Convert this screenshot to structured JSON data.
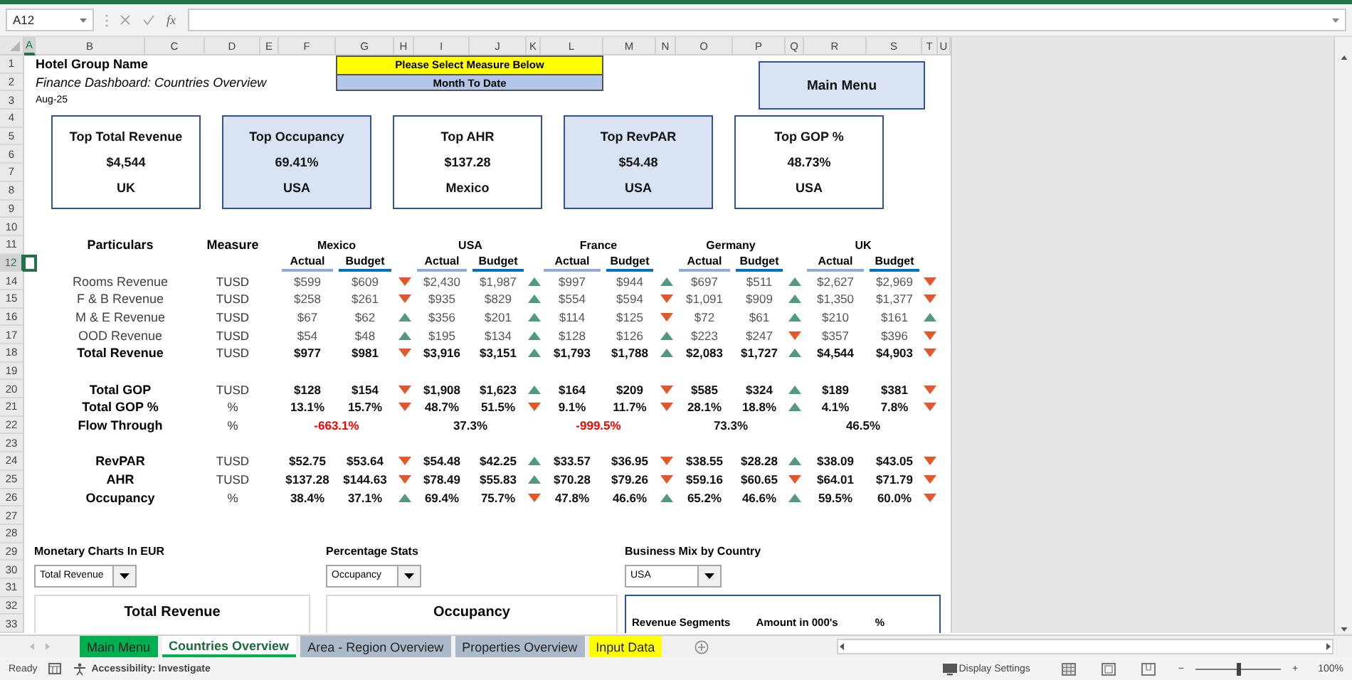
{
  "formula_bar": {
    "name_box": "A12",
    "function_label": "fx"
  },
  "columns": [
    {
      "label": "A",
      "selected": true
    },
    {
      "label": "B",
      "selected": false
    },
    {
      "label": "C",
      "selected": false
    },
    {
      "label": "D",
      "selected": false
    },
    {
      "label": "E",
      "selected": false
    },
    {
      "label": "F",
      "selected": false
    },
    {
      "label": "G",
      "selected": false
    },
    {
      "label": "H",
      "selected": false
    },
    {
      "label": "I",
      "selected": false
    },
    {
      "label": "J",
      "selected": false
    },
    {
      "label": "K",
      "selected": false
    },
    {
      "label": "L",
      "selected": false
    },
    {
      "label": "M",
      "selected": false
    },
    {
      "label": "N",
      "selected": false
    },
    {
      "label": "O",
      "selected": false
    },
    {
      "label": "P",
      "selected": false
    },
    {
      "label": "Q",
      "selected": false
    },
    {
      "label": "R",
      "selected": false
    },
    {
      "label": "S",
      "selected": false
    },
    {
      "label": "T",
      "selected": false
    },
    {
      "label": "U",
      "selected": false
    }
  ],
  "rows": [
    {
      "label": "1",
      "selected": false
    },
    {
      "label": "2",
      "selected": false
    },
    {
      "label": "3",
      "selected": false
    },
    {
      "label": "4",
      "selected": false
    },
    {
      "label": "5",
      "selected": false
    },
    {
      "label": "6",
      "selected": false
    },
    {
      "label": "7",
      "selected": false
    },
    {
      "label": "8",
      "selected": false
    },
    {
      "label": "9",
      "selected": false
    },
    {
      "label": "10",
      "selected": false
    },
    {
      "label": "11",
      "selected": false
    },
    {
      "label": "12",
      "selected": true
    },
    {
      "label": "14",
      "selected": false
    },
    {
      "label": "15",
      "selected": false
    },
    {
      "label": "16",
      "selected": false
    },
    {
      "label": "17",
      "selected": false
    },
    {
      "label": "18",
      "selected": false
    },
    {
      "label": "19",
      "selected": false
    },
    {
      "label": "20",
      "selected": false
    },
    {
      "label": "21",
      "selected": false
    },
    {
      "label": "22",
      "selected": false
    },
    {
      "label": "23",
      "selected": false
    },
    {
      "label": "24",
      "selected": false
    },
    {
      "label": "25",
      "selected": false
    },
    {
      "label": "26",
      "selected": false
    },
    {
      "label": "27",
      "selected": false
    },
    {
      "label": "28",
      "selected": false
    },
    {
      "label": "29",
      "selected": false
    },
    {
      "label": "30",
      "selected": false
    },
    {
      "label": "31",
      "selected": false
    },
    {
      "label": "32",
      "selected": false
    },
    {
      "label": "33",
      "selected": false
    }
  ],
  "header": {
    "title": "Hotel Group Name",
    "subtitle": "Finance Dashboard: Countries Overview",
    "period": "Aug-25"
  },
  "measure_selector": {
    "prompt": "Please Select Measure Below",
    "value": "Month To Date"
  },
  "main_menu_button": "Main Menu",
  "kpi_cards": [
    {
      "title": "Top Total Revenue",
      "value": "$4,544",
      "country": "UK",
      "shaded": false
    },
    {
      "title": "Top Occupancy",
      "value": "69.41%",
      "country": "USA",
      "shaded": true
    },
    {
      "title": "Top AHR",
      "value": "$137.28",
      "country": "Mexico",
      "shaded": false
    },
    {
      "title": "Top RevPAR",
      "value": "$54.48",
      "country": "USA",
      "shaded": true
    },
    {
      "title": "Top GOP %",
      "value": "48.73%",
      "country": "USA",
      "shaded": false
    }
  ],
  "table": {
    "particulars_heading": "Particulars",
    "measure_heading": "Measure",
    "countries": [
      {
        "name": "Mexico",
        "actual_heading": "Actual",
        "budget_heading": "Budget"
      },
      {
        "name": "USA",
        "actual_heading": "Actual",
        "budget_heading": "Budget"
      },
      {
        "name": "France",
        "actual_heading": "Actual",
        "budget_heading": "Budget"
      },
      {
        "name": "Germany",
        "actual_heading": "Actual",
        "budget_heading": "Budget"
      },
      {
        "name": "UK",
        "actual_heading": "Actual",
        "budget_heading": "Budget"
      }
    ],
    "sections": [
      {
        "rows": [
          {
            "kind": "pair",
            "label": "Rooms Revenue",
            "bold": false,
            "measure": "TUSD",
            "cells": [
              {
                "actual": "$599",
                "budget": "$609",
                "above_budget": false
              },
              {
                "actual": "$2,430",
                "budget": "$1,987",
                "above_budget": true
              },
              {
                "actual": "$997",
                "budget": "$944",
                "above_budget": true
              },
              {
                "actual": "$697",
                "budget": "$511",
                "above_budget": true
              },
              {
                "actual": "$2,627",
                "budget": "$2,969",
                "above_budget": false
              }
            ]
          },
          {
            "kind": "pair",
            "label": "F & B Revenue",
            "bold": false,
            "measure": "TUSD",
            "cells": [
              {
                "actual": "$258",
                "budget": "$261",
                "above_budget": false
              },
              {
                "actual": "$935",
                "budget": "$829",
                "above_budget": true
              },
              {
                "actual": "$554",
                "budget": "$594",
                "above_budget": false
              },
              {
                "actual": "$1,091",
                "budget": "$909",
                "above_budget": true
              },
              {
                "actual": "$1,350",
                "budget": "$1,377",
                "above_budget": false
              }
            ]
          },
          {
            "kind": "pair",
            "label": "M & E Revenue",
            "bold": false,
            "measure": "TUSD",
            "cells": [
              {
                "actual": "$67",
                "budget": "$62",
                "above_budget": true
              },
              {
                "actual": "$356",
                "budget": "$201",
                "above_budget": true
              },
              {
                "actual": "$114",
                "budget": "$125",
                "above_budget": false
              },
              {
                "actual": "$72",
                "budget": "$61",
                "above_budget": true
              },
              {
                "actual": "$210",
                "budget": "$161",
                "above_budget": true
              }
            ]
          },
          {
            "kind": "pair",
            "label": "OOD Revenue",
            "bold": false,
            "measure": "TUSD",
            "cells": [
              {
                "actual": "$54",
                "budget": "$48",
                "above_budget": true
              },
              {
                "actual": "$195",
                "budget": "$134",
                "above_budget": true
              },
              {
                "actual": "$128",
                "budget": "$126",
                "above_budget": true
              },
              {
                "actual": "$223",
                "budget": "$247",
                "above_budget": false
              },
              {
                "actual": "$357",
                "budget": "$396",
                "above_budget": false
              }
            ]
          },
          {
            "kind": "pair",
            "label": "Total Revenue",
            "bold": true,
            "measure": "TUSD",
            "cells": [
              {
                "actual": "$977",
                "budget": "$981",
                "above_budget": false
              },
              {
                "actual": "$3,916",
                "budget": "$3,151",
                "above_budget": true
              },
              {
                "actual": "$1,793",
                "budget": "$1,788",
                "above_budget": true
              },
              {
                "actual": "$2,083",
                "budget": "$1,727",
                "above_budget": true
              },
              {
                "actual": "$4,544",
                "budget": "$4,903",
                "above_budget": false
              }
            ]
          }
        ]
      },
      {
        "rows": [
          {
            "kind": "pair",
            "label": "Total GOP",
            "bold": true,
            "measure": "TUSD",
            "cells": [
              {
                "actual": "$128",
                "budget": "$154",
                "above_budget": false
              },
              {
                "actual": "$1,908",
                "budget": "$1,623",
                "above_budget": true
              },
              {
                "actual": "$164",
                "budget": "$209",
                "above_budget": false
              },
              {
                "actual": "$585",
                "budget": "$324",
                "above_budget": true
              },
              {
                "actual": "$189",
                "budget": "$381",
                "above_budget": false
              }
            ]
          },
          {
            "kind": "pair",
            "label": "Total GOP %",
            "bold": true,
            "measure": "%",
            "cells": [
              {
                "actual": "13.1%",
                "budget": "15.7%",
                "above_budget": false
              },
              {
                "actual": "48.7%",
                "budget": "51.5%",
                "above_budget": false
              },
              {
                "actual": "9.1%",
                "budget": "11.7%",
                "above_budget": false
              },
              {
                "actual": "28.1%",
                "budget": "18.8%",
                "above_budget": true
              },
              {
                "actual": "4.1%",
                "budget": "7.8%",
                "above_budget": false
              }
            ]
          },
          {
            "kind": "merged",
            "label": "Flow Through",
            "bold": true,
            "measure": "%",
            "cells": [
              {
                "value": "-663.1%",
                "negative": true
              },
              {
                "value": "37.3%",
                "negative": false
              },
              {
                "value": "-999.5%",
                "negative": true
              },
              {
                "value": "73.3%",
                "negative": false
              },
              {
                "value": "46.5%",
                "negative": false
              }
            ]
          }
        ]
      },
      {
        "rows": [
          {
            "kind": "pair",
            "label": "RevPAR",
            "bold": true,
            "measure": "TUSD",
            "cells": [
              {
                "actual": "$52.75",
                "budget": "$53.64",
                "above_budget": false
              },
              {
                "actual": "$54.48",
                "budget": "$42.25",
                "above_budget": true
              },
              {
                "actual": "$33.57",
                "budget": "$36.95",
                "above_budget": false
              },
              {
                "actual": "$38.55",
                "budget": "$28.28",
                "above_budget": true
              },
              {
                "actual": "$38.09",
                "budget": "$43.05",
                "above_budget": false
              }
            ]
          },
          {
            "kind": "pair",
            "label": "AHR",
            "bold": true,
            "measure": "TUSD",
            "cells": [
              {
                "actual": "$137.28",
                "budget": "$144.63",
                "above_budget": false
              },
              {
                "actual": "$78.49",
                "budget": "$55.83",
                "above_budget": true
              },
              {
                "actual": "$70.28",
                "budget": "$79.26",
                "above_budget": false
              },
              {
                "actual": "$59.16",
                "budget": "$60.65",
                "above_budget": false
              },
              {
                "actual": "$64.01",
                "budget": "$71.79",
                "above_budget": false
              }
            ]
          },
          {
            "kind": "pair",
            "label": "Occupancy",
            "bold": true,
            "measure": "%",
            "cells": [
              {
                "actual": "38.4%",
                "budget": "37.1%",
                "above_budget": true
              },
              {
                "actual": "69.4%",
                "budget": "75.7%",
                "above_budget": false
              },
              {
                "actual": "47.8%",
                "budget": "46.6%",
                "above_budget": true
              },
              {
                "actual": "65.2%",
                "budget": "46.6%",
                "above_budget": true
              },
              {
                "actual": "59.5%",
                "budget": "60.0%",
                "above_budget": false
              }
            ]
          }
        ]
      }
    ]
  },
  "panels": [
    {
      "kind": "chart",
      "heading": "Monetary Charts In EUR",
      "dropdown": "Total Revenue",
      "title": "Total Revenue"
    },
    {
      "kind": "chart",
      "heading": "Percentage Stats",
      "dropdown": "Occupancy",
      "title": "Occupancy"
    },
    {
      "kind": "table",
      "heading": "Business Mix by Country",
      "dropdown": "USA",
      "columns": [
        "Revenue Segments",
        "Amount in 000's",
        "%"
      ]
    }
  ],
  "sheet_tabs": [
    {
      "label": "Main Menu",
      "color": "#00b050",
      "selected": false
    },
    {
      "label": "Countries Overview",
      "color": "#00b050",
      "selected": true
    },
    {
      "label": "Area - Region Overview",
      "color": "#acb9ca",
      "selected": false
    },
    {
      "label": "Properties Overview",
      "color": "#acb9ca",
      "selected": false
    },
    {
      "label": "Input Data",
      "color": "#ffff00",
      "selected": false
    }
  ],
  "status_bar": {
    "mode": "Ready",
    "accessibility": "Accessibility: Investigate",
    "display_settings": "Display Settings",
    "zoom_out": "−",
    "zoom_in": "+",
    "zoom": "100%",
    "zoom_slider": {
      "level": 0.5
    }
  }
}
